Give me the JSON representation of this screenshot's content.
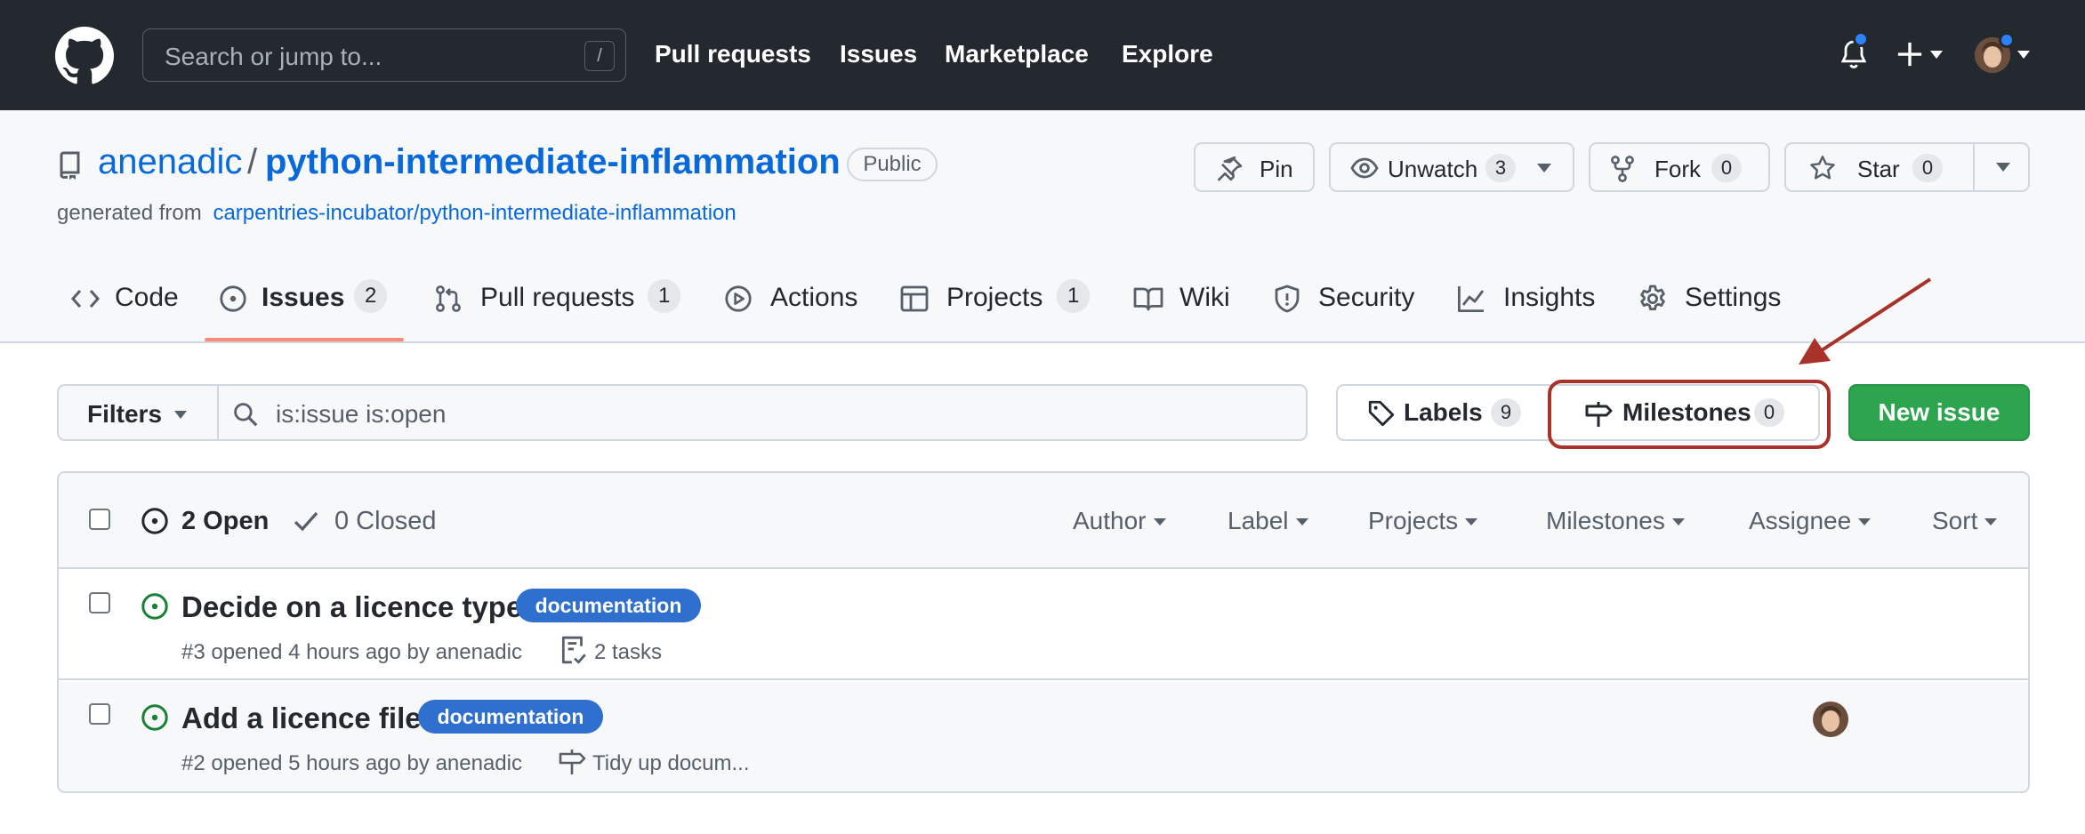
{
  "header": {
    "search_placeholder": "Search or jump to...",
    "search_shortcut": "/",
    "nav": [
      "Pull requests",
      "Issues",
      "Marketplace",
      "Explore"
    ]
  },
  "repo": {
    "owner": "anenadic",
    "separator": "/",
    "name": "python-intermediate-inflammation",
    "visibility": "Public",
    "generated_from_prefix": "generated from",
    "generated_from_link": "carpentries-incubator/python-intermediate-inflammation",
    "actions": {
      "pin": "Pin",
      "watch": "Unwatch",
      "watch_count": "3",
      "fork": "Fork",
      "fork_count": "0",
      "star": "Star",
      "star_count": "0"
    }
  },
  "tabs": [
    {
      "label": "Code",
      "icon": "code-icon"
    },
    {
      "label": "Issues",
      "count": "2",
      "icon": "issue-opened-icon",
      "selected": true
    },
    {
      "label": "Pull requests",
      "count": "1",
      "icon": "git-pull-request-icon"
    },
    {
      "label": "Actions",
      "icon": "play-icon"
    },
    {
      "label": "Projects",
      "count": "1",
      "icon": "table-icon"
    },
    {
      "label": "Wiki",
      "icon": "book-icon"
    },
    {
      "label": "Security",
      "icon": "shield-icon"
    },
    {
      "label": "Insights",
      "icon": "graph-icon"
    },
    {
      "label": "Settings",
      "icon": "gear-icon"
    }
  ],
  "toolbar": {
    "filters_label": "Filters",
    "filter_value": "is:issue is:open",
    "labels_label": "Labels",
    "labels_count": "9",
    "milestones_label": "Milestones",
    "milestones_count": "0",
    "new_issue_label": "New issue"
  },
  "issues_header": {
    "open_label": "2 Open",
    "closed_label": "0 Closed",
    "filters": [
      "Author",
      "Label",
      "Projects",
      "Milestones",
      "Assignee",
      "Sort"
    ]
  },
  "issues": [
    {
      "title": "Decide on a licence type",
      "label": "documentation",
      "meta": "#3 opened 4 hours ago by anenadic",
      "extra": "2 tasks",
      "extra_icon": "tasklist-icon"
    },
    {
      "title": "Add a licence file",
      "label": "documentation",
      "meta": "#2 opened 5 hours ago by anenadic",
      "extra": "Tidy up docum...",
      "extra_icon": "milestone-icon"
    }
  ],
  "colors": {
    "header_bg": "#24292f",
    "link_blue": "#0969da",
    "label_bg": "#2f6fce",
    "open_green": "#1a7f37",
    "new_issue_green": "#2da44e",
    "annotation_red": "#a8322a",
    "tab_underline": "#fd8c73"
  }
}
